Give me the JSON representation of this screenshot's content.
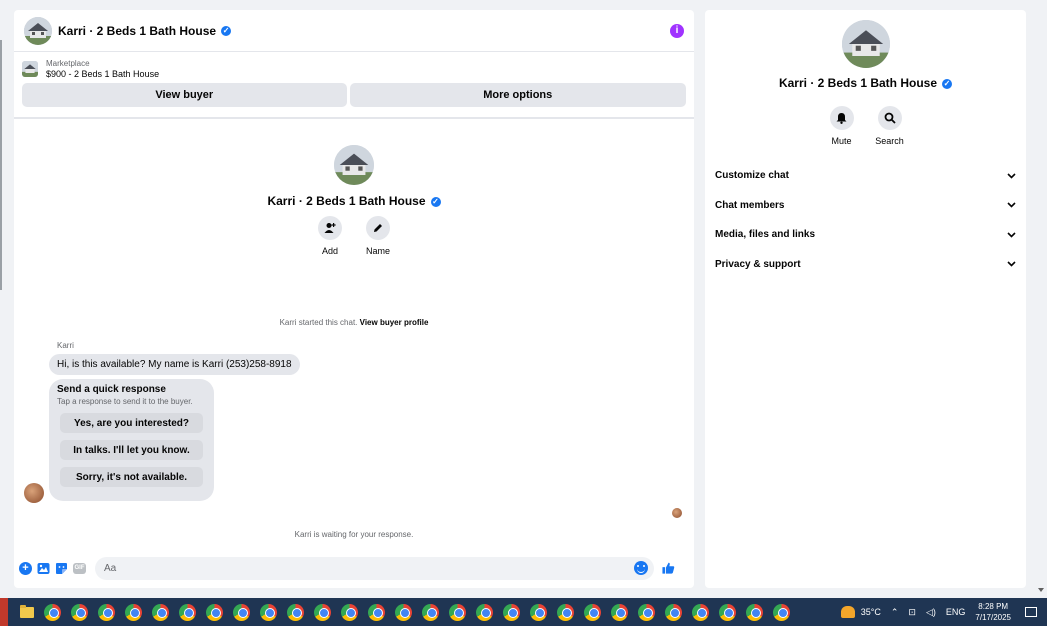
{
  "chat": {
    "title": "Karri · 2 Beds 1 Bath House",
    "verified_glyph": "✓",
    "info_glyph": "i",
    "listing": {
      "category": "Marketplace",
      "price_title": "$900 - 2 Beds 1 Bath House"
    },
    "buttons": {
      "view_buyer": "View buyer",
      "more_options": "More options"
    },
    "profile": {
      "name": "Karri · 2 Beds 1 Bath House",
      "actions": [
        {
          "label": "Add",
          "icon": "add-person-icon"
        },
        {
          "label": "Name",
          "icon": "pencil-icon"
        }
      ]
    },
    "started_prefix": "Karri started this chat.",
    "started_link": "View buyer profile",
    "sender": "Karri",
    "message": "Hi, is this available? My name is Karri (253)258-8918",
    "quick_response": {
      "title": "Send a quick response",
      "subtitle": "Tap a response to send it to the buyer.",
      "options": [
        "Yes, are you interested?",
        "In talks. I'll let you know.",
        "Sorry, it's not available."
      ]
    },
    "waiting": "Karri is waiting for your response.",
    "composer": {
      "placeholder": "Aa",
      "gif_label": "GIF"
    }
  },
  "side": {
    "name": "Karri · 2 Beds 1 Bath House",
    "actions": [
      {
        "label": "Mute",
        "icon": "bell-icon"
      },
      {
        "label": "Search",
        "icon": "search-icon"
      }
    ],
    "menu": [
      "Customize chat",
      "Chat members",
      "Media, files and links",
      "Privacy & support"
    ]
  },
  "taskbar": {
    "temperature": "35°C",
    "language": "ENG",
    "time": "8:28 PM",
    "date": "7/17/2025",
    "chrome_count": 28
  },
  "colors": {
    "accent": "#1877f2",
    "info": "#a033ff",
    "bubble": "#e4e6eb"
  }
}
